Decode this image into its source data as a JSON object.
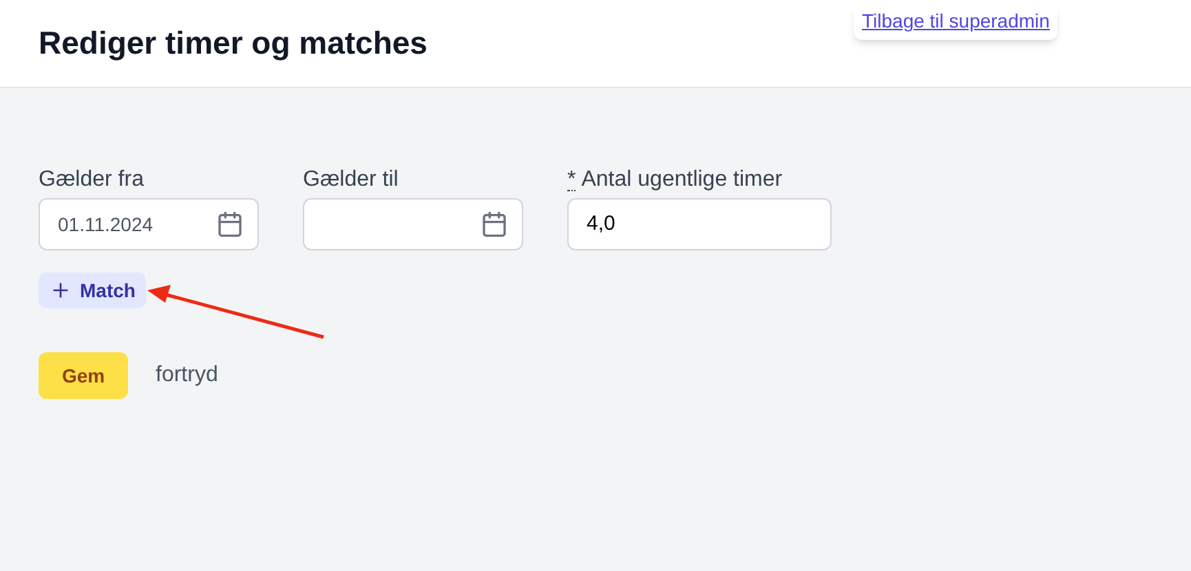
{
  "header": {
    "title": "Rediger timer og matches",
    "back_link": "Tilbage til superadmin"
  },
  "fields": [
    {
      "kind": "date",
      "label": "Gælder fra",
      "value": "01.11.2024"
    },
    {
      "kind": "date",
      "label": "Gælder til"
    },
    {
      "kind": "number",
      "label": "Antal ugentlige timer",
      "required_mark": "*",
      "value": "4,0"
    }
  ],
  "add_button": {
    "label": "Match"
  },
  "save_button": {
    "label": "Gem"
  },
  "cancel_link": {
    "label": "fortryd"
  },
  "annotation": {
    "kind": "arrow"
  }
}
